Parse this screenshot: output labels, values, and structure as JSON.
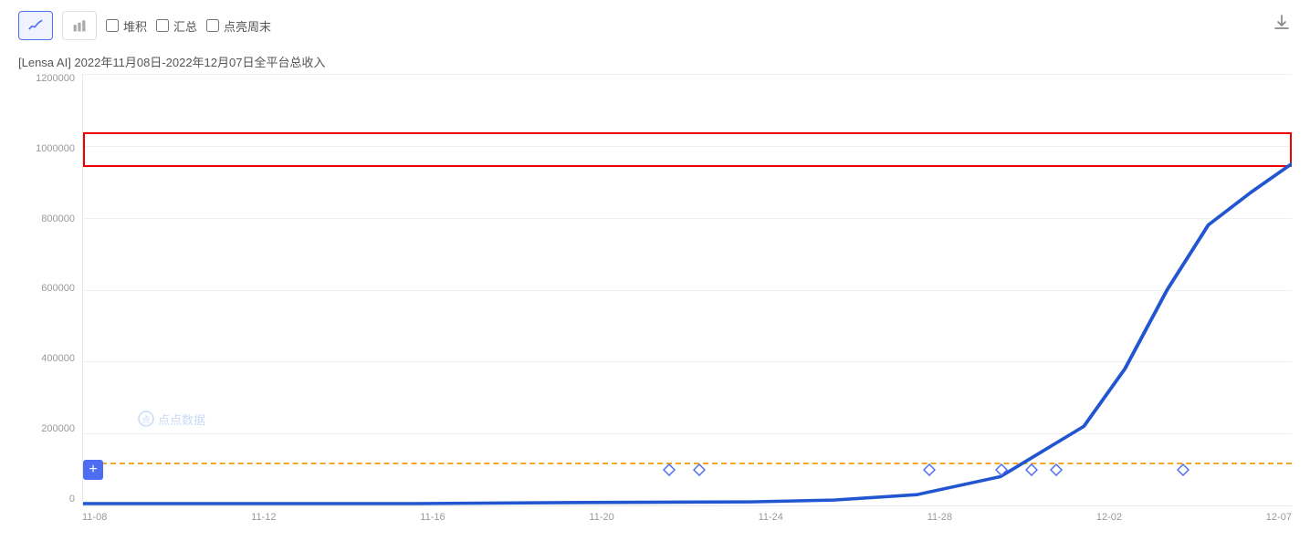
{
  "toolbar": {
    "line_chart_label": "折线图",
    "bar_chart_label": "柱状图",
    "stack_label": "堆积",
    "summary_label": "汇总",
    "highlight_weekend_label": "点亮周末",
    "download_label": "下载"
  },
  "chart": {
    "title": "[Lensa AI]  2022年11月08日-2022年12月07日全平台总收入",
    "y_labels": [
      "1200000",
      "1000000",
      "800000",
      "600000",
      "400000",
      "200000",
      "0"
    ],
    "x_labels": [
      "11-08",
      "11-12",
      "11-16",
      "11-20",
      "11-24",
      "11-28",
      "12-02",
      "12-07"
    ],
    "orange_dashed_value": 120000,
    "y_max": 1200000
  },
  "diamonds": [
    {
      "x_pct": 48.5
    },
    {
      "x_pct": 51.0
    },
    {
      "x_pct": 70.0
    },
    {
      "x_pct": 76.0
    },
    {
      "x_pct": 78.5
    },
    {
      "x_pct": 80.5
    },
    {
      "x_pct": 91.0
    }
  ],
  "watermark": {
    "text": "点点数据"
  },
  "colors": {
    "line": "#2156d0",
    "orange": "#f5a623",
    "accent": "#4e6ef2",
    "highlight_red": "#e00",
    "grid": "#f0f0f0"
  }
}
